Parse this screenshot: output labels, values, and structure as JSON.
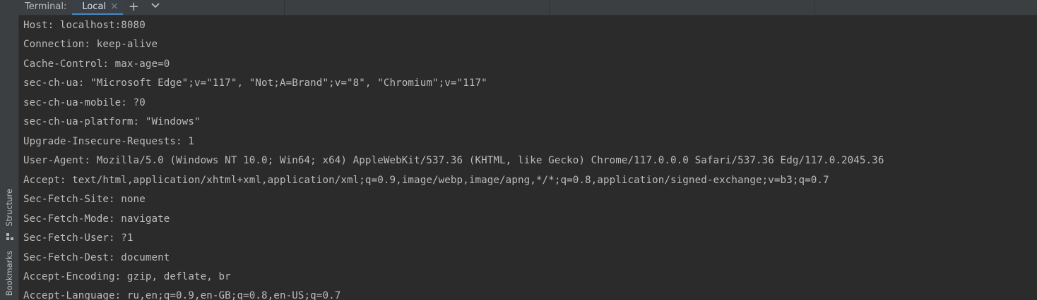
{
  "tool_window": {
    "title": "Terminal:",
    "tab_label": "Local",
    "close_glyph": "×",
    "add_glyph": "+",
    "dropdown_glyph": "⌄"
  },
  "side_strip": {
    "structure_label": "Structure",
    "bookmarks_label": "Bookmarks"
  },
  "terminal": {
    "lines": [
      "Host: localhost:8080",
      "Connection: keep-alive",
      "Cache-Control: max-age=0",
      "sec-ch-ua: \"Microsoft Edge\";v=\"117\", \"Not;A=Brand\";v=\"8\", \"Chromium\";v=\"117\"",
      "sec-ch-ua-mobile: ?0",
      "sec-ch-ua-platform: \"Windows\"",
      "Upgrade-Insecure-Requests: 1",
      "User-Agent: Mozilla/5.0 (Windows NT 10.0; Win64; x64) AppleWebKit/537.36 (KHTML, like Gecko) Chrome/117.0.0.0 Safari/537.36 Edg/117.0.2045.36",
      "Accept: text/html,application/xhtml+xml,application/xml;q=0.9,image/webp,image/apng,*/*;q=0.8,application/signed-exchange;v=b3;q=0.7",
      "Sec-Fetch-Site: none",
      "Sec-Fetch-Mode: navigate",
      "Sec-Fetch-User: ?1",
      "Sec-Fetch-Dest: document",
      "Accept-Encoding: gzip, deflate, br",
      "Accept-Language: ru,en;q=0.9,en-GB;q=0.8,en-US;q=0.7"
    ]
  },
  "colors": {
    "background": "#2b2b2b",
    "panel": "#3c3f41",
    "text": "#bbbbbb",
    "accent": "#4a88c7"
  }
}
